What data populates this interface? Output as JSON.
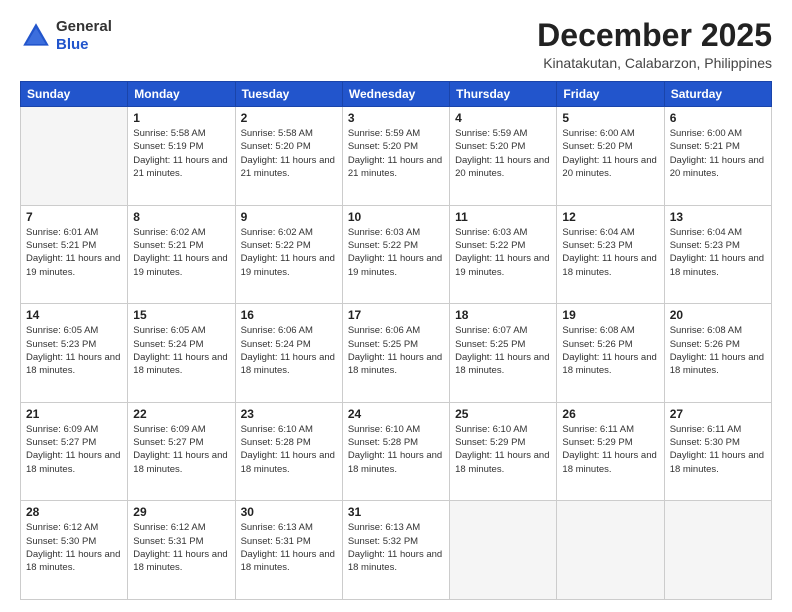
{
  "logo": {
    "general": "General",
    "blue": "Blue"
  },
  "header": {
    "month": "December 2025",
    "location": "Kinatakutan, Calabarzon, Philippines"
  },
  "days_of_week": [
    "Sunday",
    "Monday",
    "Tuesday",
    "Wednesday",
    "Thursday",
    "Friday",
    "Saturday"
  ],
  "weeks": [
    [
      {
        "day": "",
        "info": ""
      },
      {
        "day": "1",
        "info": "Sunrise: 5:58 AM\nSunset: 5:19 PM\nDaylight: 11 hours\nand 21 minutes."
      },
      {
        "day": "2",
        "info": "Sunrise: 5:58 AM\nSunset: 5:20 PM\nDaylight: 11 hours\nand 21 minutes."
      },
      {
        "day": "3",
        "info": "Sunrise: 5:59 AM\nSunset: 5:20 PM\nDaylight: 11 hours\nand 21 minutes."
      },
      {
        "day": "4",
        "info": "Sunrise: 5:59 AM\nSunset: 5:20 PM\nDaylight: 11 hours\nand 20 minutes."
      },
      {
        "day": "5",
        "info": "Sunrise: 6:00 AM\nSunset: 5:20 PM\nDaylight: 11 hours\nand 20 minutes."
      },
      {
        "day": "6",
        "info": "Sunrise: 6:00 AM\nSunset: 5:21 PM\nDaylight: 11 hours\nand 20 minutes."
      }
    ],
    [
      {
        "day": "7",
        "info": "Sunrise: 6:01 AM\nSunset: 5:21 PM\nDaylight: 11 hours\nand 19 minutes."
      },
      {
        "day": "8",
        "info": "Sunrise: 6:02 AM\nSunset: 5:21 PM\nDaylight: 11 hours\nand 19 minutes."
      },
      {
        "day": "9",
        "info": "Sunrise: 6:02 AM\nSunset: 5:22 PM\nDaylight: 11 hours\nand 19 minutes."
      },
      {
        "day": "10",
        "info": "Sunrise: 6:03 AM\nSunset: 5:22 PM\nDaylight: 11 hours\nand 19 minutes."
      },
      {
        "day": "11",
        "info": "Sunrise: 6:03 AM\nSunset: 5:22 PM\nDaylight: 11 hours\nand 19 minutes."
      },
      {
        "day": "12",
        "info": "Sunrise: 6:04 AM\nSunset: 5:23 PM\nDaylight: 11 hours\nand 18 minutes."
      },
      {
        "day": "13",
        "info": "Sunrise: 6:04 AM\nSunset: 5:23 PM\nDaylight: 11 hours\nand 18 minutes."
      }
    ],
    [
      {
        "day": "14",
        "info": "Sunrise: 6:05 AM\nSunset: 5:23 PM\nDaylight: 11 hours\nand 18 minutes."
      },
      {
        "day": "15",
        "info": "Sunrise: 6:05 AM\nSunset: 5:24 PM\nDaylight: 11 hours\nand 18 minutes."
      },
      {
        "day": "16",
        "info": "Sunrise: 6:06 AM\nSunset: 5:24 PM\nDaylight: 11 hours\nand 18 minutes."
      },
      {
        "day": "17",
        "info": "Sunrise: 6:06 AM\nSunset: 5:25 PM\nDaylight: 11 hours\nand 18 minutes."
      },
      {
        "day": "18",
        "info": "Sunrise: 6:07 AM\nSunset: 5:25 PM\nDaylight: 11 hours\nand 18 minutes."
      },
      {
        "day": "19",
        "info": "Sunrise: 6:08 AM\nSunset: 5:26 PM\nDaylight: 11 hours\nand 18 minutes."
      },
      {
        "day": "20",
        "info": "Sunrise: 6:08 AM\nSunset: 5:26 PM\nDaylight: 11 hours\nand 18 minutes."
      }
    ],
    [
      {
        "day": "21",
        "info": "Sunrise: 6:09 AM\nSunset: 5:27 PM\nDaylight: 11 hours\nand 18 minutes."
      },
      {
        "day": "22",
        "info": "Sunrise: 6:09 AM\nSunset: 5:27 PM\nDaylight: 11 hours\nand 18 minutes."
      },
      {
        "day": "23",
        "info": "Sunrise: 6:10 AM\nSunset: 5:28 PM\nDaylight: 11 hours\nand 18 minutes."
      },
      {
        "day": "24",
        "info": "Sunrise: 6:10 AM\nSunset: 5:28 PM\nDaylight: 11 hours\nand 18 minutes."
      },
      {
        "day": "25",
        "info": "Sunrise: 6:10 AM\nSunset: 5:29 PM\nDaylight: 11 hours\nand 18 minutes."
      },
      {
        "day": "26",
        "info": "Sunrise: 6:11 AM\nSunset: 5:29 PM\nDaylight: 11 hours\nand 18 minutes."
      },
      {
        "day": "27",
        "info": "Sunrise: 6:11 AM\nSunset: 5:30 PM\nDaylight: 11 hours\nand 18 minutes."
      }
    ],
    [
      {
        "day": "28",
        "info": "Sunrise: 6:12 AM\nSunset: 5:30 PM\nDaylight: 11 hours\nand 18 minutes."
      },
      {
        "day": "29",
        "info": "Sunrise: 6:12 AM\nSunset: 5:31 PM\nDaylight: 11 hours\nand 18 minutes."
      },
      {
        "day": "30",
        "info": "Sunrise: 6:13 AM\nSunset: 5:31 PM\nDaylight: 11 hours\nand 18 minutes."
      },
      {
        "day": "31",
        "info": "Sunrise: 6:13 AM\nSunset: 5:32 PM\nDaylight: 11 hours\nand 18 minutes."
      },
      {
        "day": "",
        "info": ""
      },
      {
        "day": "",
        "info": ""
      },
      {
        "day": "",
        "info": ""
      }
    ]
  ]
}
